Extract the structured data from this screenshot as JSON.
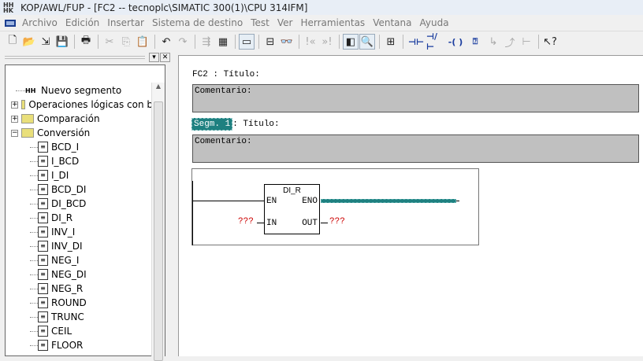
{
  "window": {
    "title": "KOP/AWL/FUP  - [FC2 -- tecnoplc\\SIMATIC 300(1)\\CPU 314IFM]"
  },
  "menu": [
    "Archivo",
    "Edición",
    "Insertar",
    "Sistema de destino",
    "Test",
    "Ver",
    "Herramientas",
    "Ventana",
    "Ayuda"
  ],
  "toolbar": [
    {
      "icon": "new-icon",
      "g": "🗋"
    },
    {
      "icon": "open-icon",
      "g": "📂"
    },
    {
      "icon": "accessible-nodes-icon",
      "g": "⇲"
    },
    {
      "icon": "save-icon",
      "g": "💾"
    },
    {
      "sep": true
    },
    {
      "icon": "print-icon",
      "g": "🖶"
    },
    {
      "sep": true
    },
    {
      "icon": "cut-icon",
      "g": "✂",
      "dis": true
    },
    {
      "icon": "copy-icon",
      "g": "⎘",
      "dis": true
    },
    {
      "icon": "paste-icon",
      "g": "📋",
      "dis": true
    },
    {
      "sep": true
    },
    {
      "icon": "undo-icon",
      "g": "↶"
    },
    {
      "icon": "redo-icon",
      "g": "↷",
      "dis": true
    },
    {
      "sep": true
    },
    {
      "icon": "download-icon",
      "g": "⇶",
      "dis": true
    },
    {
      "icon": "module-icon",
      "g": "▦"
    },
    {
      "sep": true
    },
    {
      "icon": "overview-icon",
      "g": "▭",
      "on": true
    },
    {
      "sep": true
    },
    {
      "icon": "network-icon",
      "g": "⊟"
    },
    {
      "icon": "monitor-icon",
      "g": "👓",
      "dis": true
    },
    {
      "sep": true
    },
    {
      "icon": "prev-error-icon",
      "g": "!«",
      "dis": true
    },
    {
      "icon": "next-error-icon",
      "g": "»!",
      "dis": true
    },
    {
      "sep": true
    },
    {
      "icon": "overview-window-icon",
      "g": "◧",
      "on": true
    },
    {
      "icon": "details-icon",
      "g": "🔍",
      "on": true
    },
    {
      "sep": true
    },
    {
      "icon": "new-segment-icon",
      "g": "⊞"
    },
    {
      "sep": true
    },
    {
      "icon": "no-contact-icon",
      "g": "⊣⊢",
      "blue": true
    },
    {
      "icon": "nc-contact-icon",
      "g": "⊣/⊢",
      "blue": true
    },
    {
      "icon": "coil-icon",
      "g": "-( )",
      "blue": true
    },
    {
      "icon": "empty-box-icon",
      "g": "⍰",
      "blue": true
    },
    {
      "icon": "open-branch-icon",
      "g": "↳",
      "dis": true
    },
    {
      "icon": "close-branch-icon",
      "g": "⤴",
      "dis": true
    },
    {
      "icon": "connection-icon",
      "g": "⊢",
      "dis": true
    },
    {
      "sep": true
    },
    {
      "icon": "help-icon",
      "g": "↖?"
    }
  ],
  "tree": {
    "items": [
      {
        "label": "Nuevo segmento",
        "kind": "seg",
        "level": 0
      },
      {
        "label": "Operaciones lógicas con b",
        "kind": "folder",
        "exp": "+",
        "level": 0
      },
      {
        "label": "Comparación",
        "kind": "folder",
        "exp": "+",
        "level": 0
      },
      {
        "label": "Conversión",
        "kind": "folder",
        "exp": "−",
        "level": 0
      },
      {
        "label": "BCD_I",
        "kind": "fb"
      },
      {
        "label": "I_BCD",
        "kind": "fb"
      },
      {
        "label": "I_DI",
        "kind": "fb"
      },
      {
        "label": "BCD_DI",
        "kind": "fb"
      },
      {
        "label": "DI_BCD",
        "kind": "fb"
      },
      {
        "label": "DI_R",
        "kind": "fb"
      },
      {
        "label": "INV_I",
        "kind": "fb"
      },
      {
        "label": "INV_DI",
        "kind": "fb"
      },
      {
        "label": "NEG_I",
        "kind": "fb"
      },
      {
        "label": "NEG_DI",
        "kind": "fb"
      },
      {
        "label": "NEG_R",
        "kind": "fb"
      },
      {
        "label": "ROUND",
        "kind": "fb"
      },
      {
        "label": "TRUNC",
        "kind": "fb"
      },
      {
        "label": "CEIL",
        "kind": "fb"
      },
      {
        "label": "FLOOR",
        "kind": "fb"
      }
    ]
  },
  "editor": {
    "block_title": "FC2 : Título:",
    "block_comment": "Comentario:",
    "segment_label": "Segm. 1",
    "segment_title": ": Título:",
    "segment_comment": "Comentario:",
    "box": {
      "name": "DI_R",
      "en": "EN",
      "eno": "ENO",
      "in": "IN",
      "out": "OUT",
      "in_value": "???",
      "out_value": "???"
    }
  },
  "colors": {
    "selection": "#1e8080",
    "comment_bg": "#c0c0c0",
    "undefined_operand": "#cc0000"
  }
}
